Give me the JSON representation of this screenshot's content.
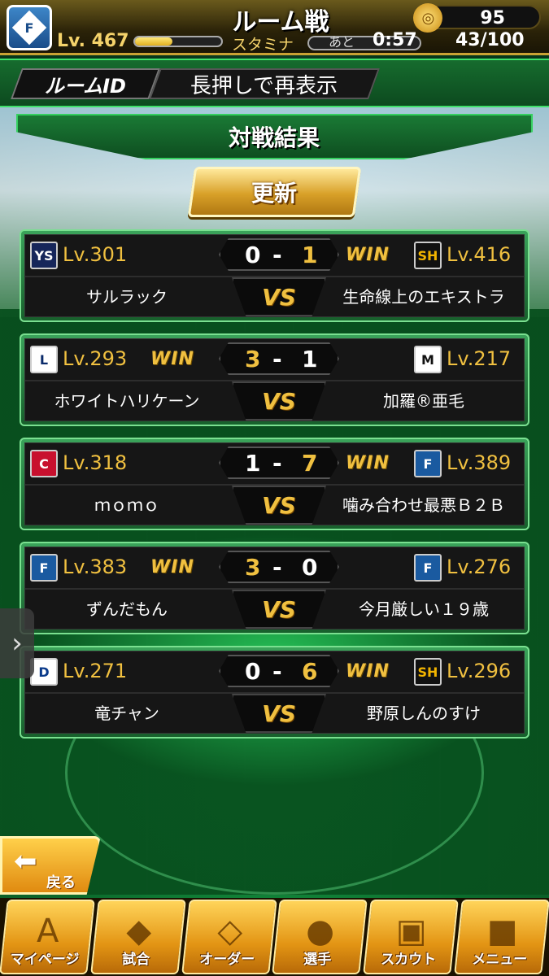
{
  "header": {
    "team_icon_letter": "F",
    "title": "ルーム戦",
    "coin_icon": "coin-icon",
    "coins": "95",
    "level": "Lv. 467",
    "stamina_label": "スタミナ",
    "stamina_fill": 0.43,
    "ato_label": "あと",
    "timer": "0:57",
    "stamina_count": "43/100"
  },
  "room": {
    "tag": "ルームID",
    "text": "長押しで再表示"
  },
  "results": {
    "title": "対戦結果",
    "refresh_label": "更新",
    "vs_label": "VS",
    "win_label": "WIN",
    "matches": [
      {
        "left_team": "swallows",
        "left_logo": "YS",
        "left_level": "Lv.301",
        "left_name": "サルラック",
        "left_score": "0",
        "right_score": "1",
        "right_team": "hawks",
        "right_logo": "SH",
        "right_level": "Lv.416",
        "right_name": "生命線上のエキストラ",
        "winner": "right"
      },
      {
        "left_team": "lions",
        "left_logo": "L",
        "left_level": "Lv.293",
        "left_name": "ホワイトハリケーン",
        "left_score": "3",
        "right_score": "1",
        "right_team": "marines",
        "right_logo": "M",
        "right_level": "Lv.217",
        "right_name": "加羅®亜毛",
        "winner": "left"
      },
      {
        "left_team": "carp",
        "left_logo": "C",
        "left_level": "Lv.318",
        "left_name": "ｍｏｍｏ",
        "left_score": "1",
        "right_score": "7",
        "right_team": "fighters",
        "right_logo": "F",
        "right_level": "Lv.389",
        "right_name": "噛み合わせ最悪Ｂ２Ｂ",
        "winner": "right"
      },
      {
        "left_team": "fighters",
        "left_logo": "F",
        "left_level": "Lv.383",
        "left_name": "ずんだもん",
        "left_score": "3",
        "right_score": "0",
        "right_team": "fighters",
        "right_logo": "F",
        "right_level": "Lv.276",
        "right_name": "今月厳しい１９歳",
        "winner": "left"
      },
      {
        "left_team": "dragons",
        "left_logo": "D",
        "left_level": "Lv.271",
        "left_name": "竜チャン",
        "left_score": "0",
        "right_score": "6",
        "right_team": "hawks",
        "right_logo": "SH",
        "right_level": "Lv.296",
        "right_name": "野原しんのすけ",
        "winner": "right"
      }
    ]
  },
  "side_tab_icon": "›",
  "back": {
    "label": "戻る",
    "icon": "back-arrow-icon"
  },
  "nav": [
    {
      "label": "マイページ",
      "icon": "mypage-icon",
      "glyph": "A"
    },
    {
      "label": "試合",
      "icon": "stadium-icon",
      "glyph": "◆"
    },
    {
      "label": "オーダー",
      "icon": "order-icon",
      "glyph": "◇"
    },
    {
      "label": "選手",
      "icon": "player-icon",
      "glyph": "●"
    },
    {
      "label": "スカウト",
      "icon": "scout-icon",
      "glyph": "▣"
    },
    {
      "label": "メニュー",
      "icon": "menu-icon",
      "glyph": "■"
    }
  ]
}
